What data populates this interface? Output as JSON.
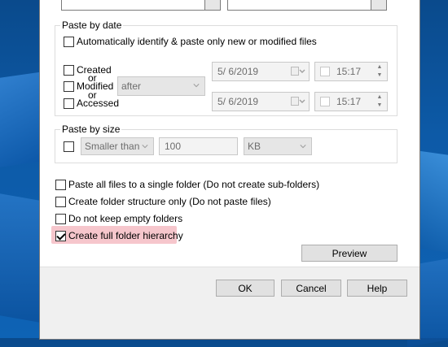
{
  "paste_by_date": {
    "title": "Paste by date",
    "auto_identify_label": "Automatically identify & paste only new or modified files",
    "created_label": "Created",
    "or1": "or",
    "modified_label": "Modified",
    "or2": "or",
    "accessed_label": "Accessed",
    "relation_value": "after",
    "date1": "5/  6/2019",
    "time1": "15:17",
    "date2": "5/  6/2019",
    "time2": "15:17"
  },
  "paste_by_size": {
    "title": "Paste by size",
    "comparison_value": "Smaller than",
    "size_value": "100",
    "unit_value": "KB"
  },
  "options": {
    "single_folder": "Paste all files to a single folder (Do not create sub-folders)",
    "structure_only": "Create folder structure only (Do not paste files)",
    "no_empty": "Do not keep empty folders",
    "full_hierarchy": "Create full folder hierarchy"
  },
  "buttons": {
    "preview": "Preview",
    "ok": "OK",
    "cancel": "Cancel",
    "help": "Help"
  },
  "colors": {
    "highlight": "#f6c6cc",
    "desktop": "#0d5aa7"
  }
}
